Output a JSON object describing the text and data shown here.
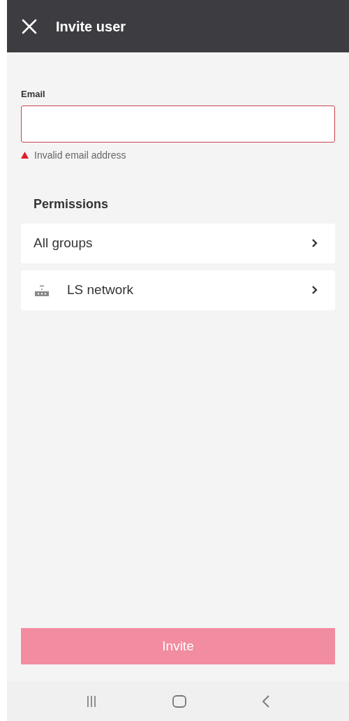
{
  "header": {
    "title": "Invite user"
  },
  "email": {
    "label": "Email",
    "invalid": true,
    "error": "Invalid email address"
  },
  "permissions": {
    "title": "Permissions",
    "items": [
      {
        "label": "All groups",
        "kind": "plain"
      },
      {
        "label": "LS network",
        "kind": "network"
      }
    ]
  },
  "invite_button": {
    "label": "Invite",
    "disabled": true
  }
}
